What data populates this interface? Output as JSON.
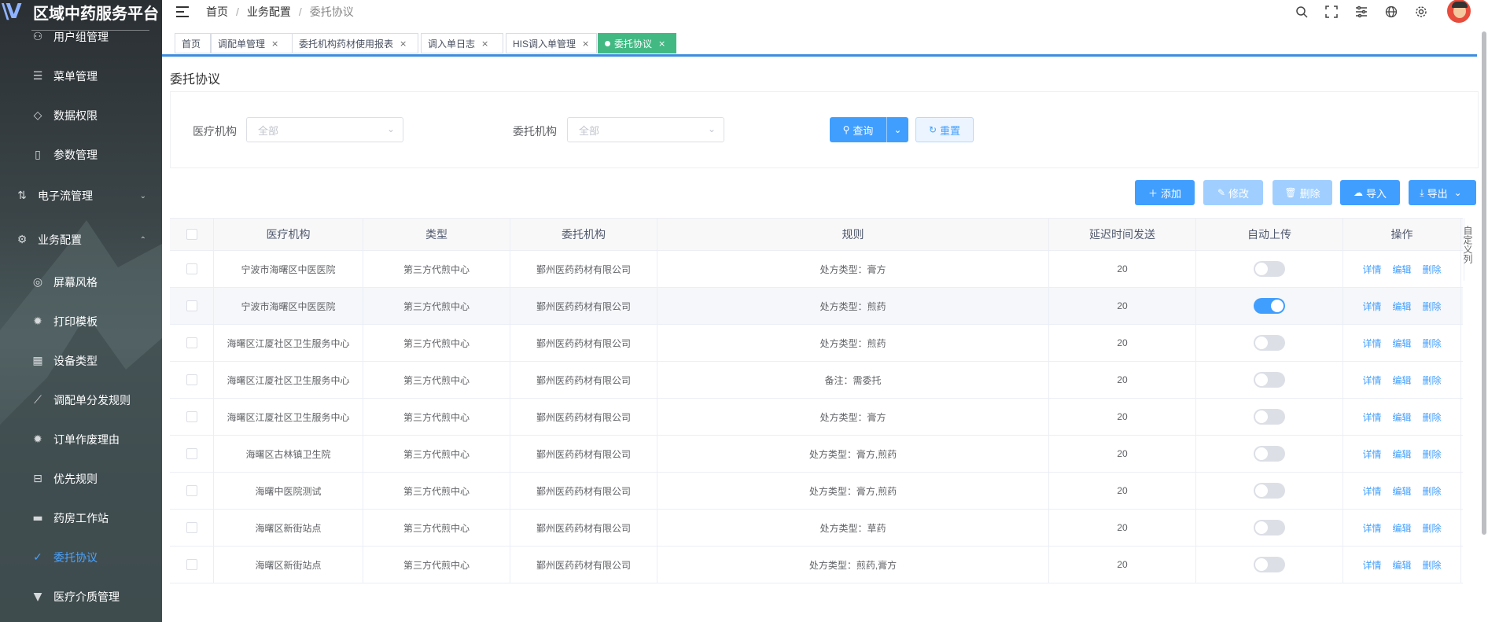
{
  "brand": {
    "logo": "\\V",
    "title": "区域中药服务平台"
  },
  "sidebar": {
    "items": [
      {
        "label": "用户组管理",
        "icon": "org-icon",
        "glyph": "⚇",
        "type": "sub"
      },
      {
        "label": "菜单管理",
        "icon": "menu-icon",
        "glyph": "☰",
        "type": "sub"
      },
      {
        "label": "数据权限",
        "icon": "shield-icon",
        "glyph": "◇",
        "type": "sub"
      },
      {
        "label": "参数管理",
        "icon": "document-icon",
        "glyph": "▯",
        "type": "sub"
      },
      {
        "label": "电子流管理",
        "icon": "flow-icon",
        "glyph": "⇅",
        "type": "group",
        "arrow": "⌄"
      },
      {
        "label": "业务配置",
        "icon": "gear-icon",
        "glyph": "⚙",
        "type": "group",
        "arrow": "⌃"
      },
      {
        "label": "屏幕风格",
        "icon": "palette-icon",
        "glyph": "◎",
        "type": "sub"
      },
      {
        "label": "打印模板",
        "icon": "settings-icon",
        "glyph": "✹",
        "type": "sub"
      },
      {
        "label": "设备类型",
        "icon": "grid-icon",
        "glyph": "▦",
        "type": "sub"
      },
      {
        "label": "调配单分发规则",
        "icon": "rule-icon",
        "glyph": "⟋",
        "type": "sub"
      },
      {
        "label": "订单作废理由",
        "icon": "cog-icon",
        "glyph": "✹",
        "type": "sub"
      },
      {
        "label": "优先规则",
        "icon": "inbox-icon",
        "glyph": "⊟",
        "type": "sub"
      },
      {
        "label": "药房工作站",
        "icon": "monitor-icon",
        "glyph": "▬",
        "type": "sub"
      },
      {
        "label": "委托协议",
        "icon": "check-circle-icon",
        "glyph": "✓",
        "type": "sub",
        "active": true
      },
      {
        "label": "医疗介质管理",
        "icon": "stamp-icon",
        "glyph": "▼",
        "type": "sub"
      }
    ]
  },
  "header": {
    "breadcrumb": [
      "首页",
      "业务配置",
      "委托协议"
    ],
    "separator": "/"
  },
  "tags": [
    {
      "label": "首页",
      "closable": false
    },
    {
      "label": "调配单管理",
      "closable": true
    },
    {
      "label": "委托机构药材使用报表",
      "closable": true
    },
    {
      "label": "调入单日志",
      "closable": true
    },
    {
      "label": "HIS调入单管理",
      "closable": true
    },
    {
      "label": "委托协议",
      "closable": true,
      "active": true
    }
  ],
  "close_glyph": "×",
  "page_title": "委托协议",
  "filters": {
    "medical_label": "医疗机构",
    "medical_placeholder": "全部",
    "entrusted_label": "委托机构",
    "entrusted_placeholder": "全部",
    "query_label": "查询",
    "reset_label": "重置"
  },
  "toolbar": {
    "add": "添加",
    "edit": "修改",
    "delete": "删除",
    "import": "导入",
    "export": "导出"
  },
  "table": {
    "columns": [
      "医疗机构",
      "类型",
      "委托机构",
      "规则",
      "延迟时间发送",
      "自动上传",
      "操作"
    ],
    "rows": [
      {
        "medical": "宁波市海曙区中医医院",
        "type": "第三方代煎中心",
        "entrusted": "鄞州医药药材有限公司",
        "rule": "处方类型：膏方",
        "delay": "20",
        "auto": false
      },
      {
        "medical": "宁波市海曙区中医医院",
        "type": "第三方代煎中心",
        "entrusted": "鄞州医药药材有限公司",
        "rule": "处方类型：煎药",
        "delay": "20",
        "auto": true
      },
      {
        "medical": "海曙区江厦社区卫生服务中心",
        "type": "第三方代煎中心",
        "entrusted": "鄞州医药药材有限公司",
        "rule": "处方类型：煎药",
        "delay": "20",
        "auto": false
      },
      {
        "medical": "海曙区江厦社区卫生服务中心",
        "type": "第三方代煎中心",
        "entrusted": "鄞州医药药材有限公司",
        "rule": "备注：需委托",
        "delay": "20",
        "auto": false
      },
      {
        "medical": "海曙区江厦社区卫生服务中心",
        "type": "第三方代煎中心",
        "entrusted": "鄞州医药药材有限公司",
        "rule": "处方类型：膏方",
        "delay": "20",
        "auto": false
      },
      {
        "medical": "海曙区古林镇卫生院",
        "type": "第三方代煎中心",
        "entrusted": "鄞州医药药材有限公司",
        "rule": "处方类型：膏方,煎药",
        "delay": "20",
        "auto": false
      },
      {
        "medical": "海曙中医院测试",
        "type": "第三方代煎中心",
        "entrusted": "鄞州医药药材有限公司",
        "rule": "处方类型：膏方,煎药",
        "delay": "20",
        "auto": false
      },
      {
        "medical": "海曙区新街站点",
        "type": "第三方代煎中心",
        "entrusted": "鄞州医药药材有限公司",
        "rule": "处方类型：草药",
        "delay": "20",
        "auto": false
      },
      {
        "medical": "海曙区新街站点",
        "type": "第三方代煎中心",
        "entrusted": "鄞州医药药材有限公司",
        "rule": "处方类型：煎药,膏方",
        "delay": "20",
        "auto": false
      }
    ],
    "ops": [
      "详情",
      "编辑",
      "删除"
    ]
  },
  "column_settings_label": "自定义列"
}
